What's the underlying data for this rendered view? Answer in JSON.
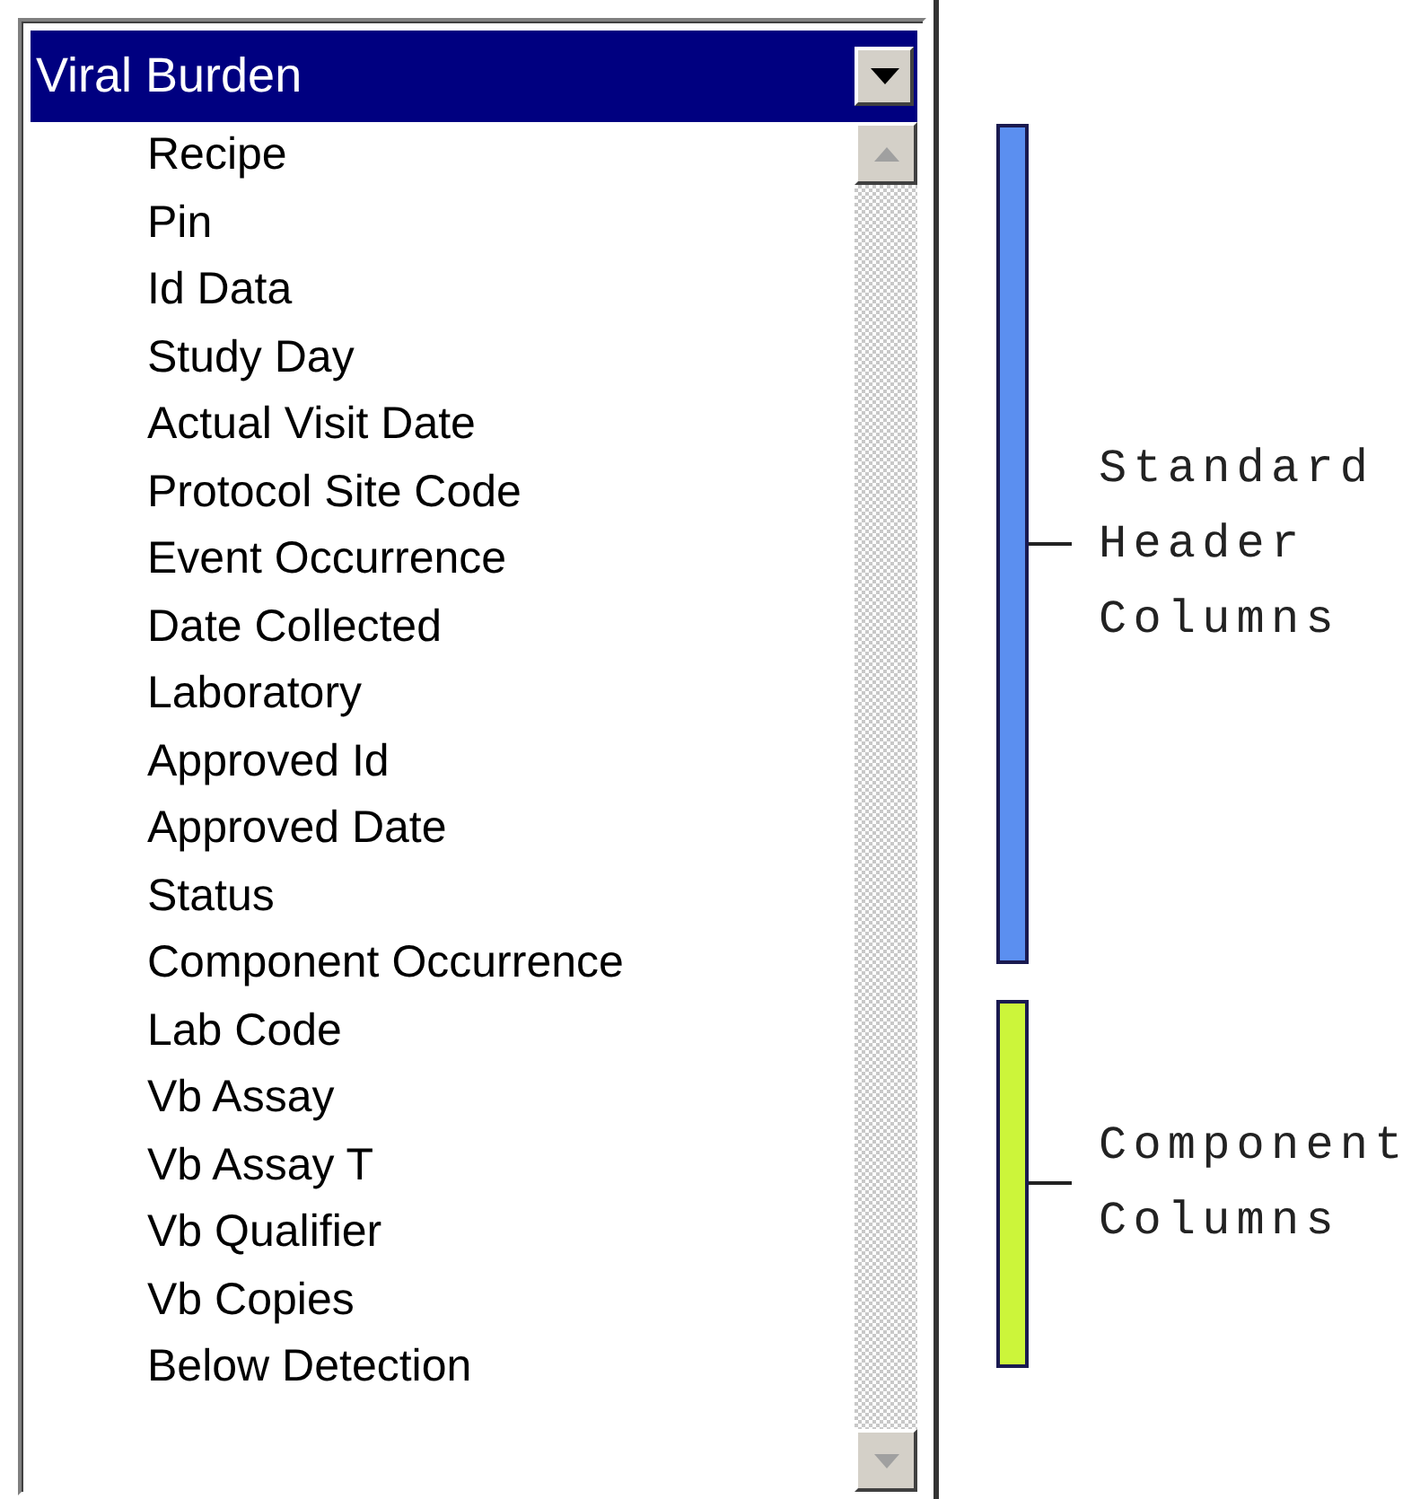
{
  "dropdown": {
    "value": "Viral Burden"
  },
  "groups": [
    {
      "items": [
        "Recipe",
        "Pin",
        "Id Data",
        "Study Day",
        "Actual Visit Date",
        "Protocol Site Code",
        "Event Occurrence",
        "Date Collected",
        "Laboratory",
        "Approved Id",
        "Approved Date",
        "Status",
        "Component Occurrence"
      ],
      "annotation": {
        "label": "Standard\nHeader\nColumns",
        "color": "#5b8ff0"
      }
    },
    {
      "items": [
        "Lab Code",
        "Vb Assay",
        "Vb Assay T",
        "Vb Qualifier",
        "Vb Copies",
        "Below Detection"
      ],
      "annotation": {
        "label": "Component\nColumns",
        "color": "#ccf53a"
      }
    }
  ]
}
